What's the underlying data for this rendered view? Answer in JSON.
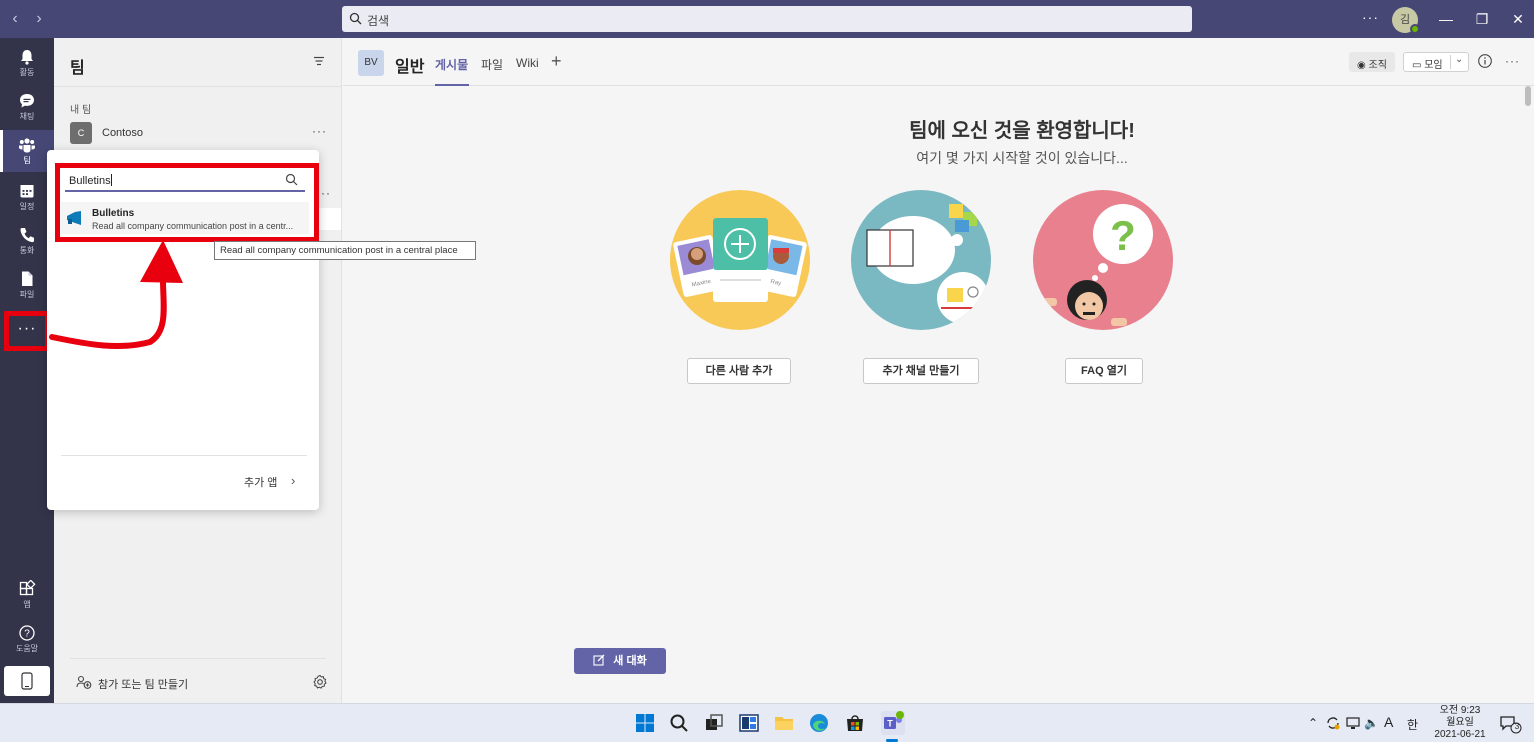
{
  "titlebar": {
    "search_placeholder": "검색",
    "avatar_initial": "김"
  },
  "rail": {
    "items": [
      {
        "label": "활동"
      },
      {
        "label": "채팅"
      },
      {
        "label": "팀"
      },
      {
        "label": "일정"
      },
      {
        "label": "통화"
      },
      {
        "label": "파일"
      }
    ],
    "apps_label": "앱",
    "help_label": "도움말"
  },
  "teams_panel": {
    "title": "팀",
    "my_teams_label": "내 팀",
    "teams": [
      {
        "initial": "C",
        "name": "Contoso"
      }
    ],
    "join_create_label": "참가 또는 팀 만들기"
  },
  "app_flyout": {
    "search_value": "Bulletins",
    "result": {
      "name": "Bulletins",
      "description": "Read all company communication post in a centr..."
    },
    "more_apps_label": "추가 앱"
  },
  "tooltip": {
    "text": "Read all company communication post in a central place"
  },
  "channel": {
    "avatar_initials": "BV",
    "name": "일반",
    "tabs": [
      {
        "label": "게시물",
        "active": true
      },
      {
        "label": "파일"
      },
      {
        "label": "Wiki"
      }
    ],
    "org_label": "조직",
    "meet_label": "모임"
  },
  "welcome": {
    "title": "팀에 오신 것을 환영합니다!",
    "subtitle": "여기 몇 가지 시작할 것이 있습니다...",
    "actions": [
      {
        "label": "다른 사람 추가",
        "circle_color": "#f8c957"
      },
      {
        "label": "추가 채널 만들기",
        "circle_color": "#7ab8c2"
      },
      {
        "label": "FAQ 열기",
        "circle_color": "#e8808e"
      }
    ],
    "illustration_names": [
      "Maxine",
      "Ray"
    ]
  },
  "new_chat_label": "새 대화",
  "taskbar": {
    "ime_label": "A",
    "ime_mode": "한",
    "time": "오전 9:23",
    "weekday": "월요일",
    "date": "2021-06-21",
    "notification_count": "3"
  },
  "colors": {
    "brand": "#6264a7",
    "titlebar": "#464775",
    "rail": "#33344a",
    "annotation_red": "#e8000e"
  }
}
